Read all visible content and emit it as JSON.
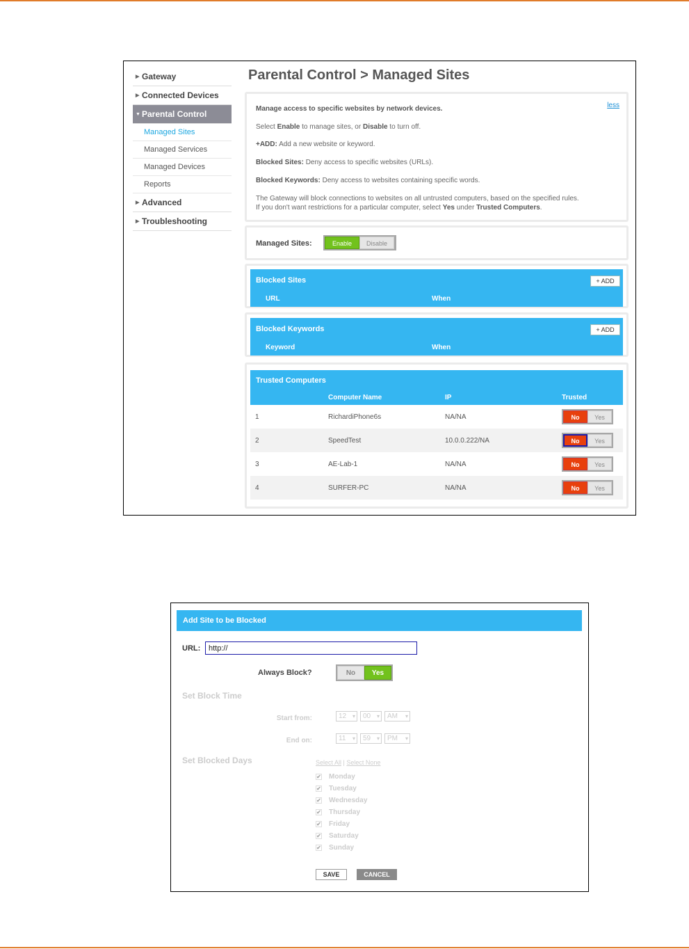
{
  "sidebar": {
    "items": [
      {
        "label": "Gateway"
      },
      {
        "label": "Connected Devices"
      },
      {
        "label": "Parental Control"
      },
      {
        "label": "Managed Sites"
      },
      {
        "label": "Managed Services"
      },
      {
        "label": "Managed Devices"
      },
      {
        "label": "Reports"
      },
      {
        "label": "Advanced"
      },
      {
        "label": "Troubleshooting"
      }
    ]
  },
  "page": {
    "title": "Parental Control > Managed Sites"
  },
  "info": {
    "less": "less",
    "line1": "Manage access to specific websites by network devices.",
    "line2a": "Select ",
    "line2b": "Enable",
    "line2c": " to manage sites, or ",
    "line2d": "Disable",
    "line2e": " to turn off.",
    "line3a": "+ADD:",
    "line3b": " Add a new website or keyword.",
    "line4a": "Blocked Sites:",
    "line4b": " Deny access to specific websites (URLs).",
    "line5a": "Blocked Keywords:",
    "line5b": " Deny access to websites containing specific words.",
    "line6": "The Gateway will block connections to websites on all untrusted computers, based on the specified rules.",
    "line7a": "If you don't want restrictions for a particular computer, select ",
    "line7b": "Yes",
    "line7c": " under ",
    "line7d": "Trusted Computers",
    "line7e": "."
  },
  "managed_sites": {
    "label": "Managed Sites:",
    "enable": "Enable",
    "disable": "Disable"
  },
  "blocked_sites": {
    "title": "Blocked Sites",
    "add": "+ ADD",
    "col_url": "URL",
    "col_when": "When"
  },
  "blocked_keywords": {
    "title": "Blocked Keywords",
    "add": "+ ADD",
    "col_keyword": "Keyword",
    "col_when": "When"
  },
  "trusted": {
    "title": "Trusted Computers",
    "col_name": "Computer Name",
    "col_ip": "IP",
    "col_trusted": "Trusted",
    "no": "No",
    "yes": "Yes",
    "rows": [
      {
        "num": "1",
        "name": "RichardiPhone6s",
        "ip": "NA/NA"
      },
      {
        "num": "2",
        "name": "SpeedTest",
        "ip": "10.0.0.222/NA"
      },
      {
        "num": "3",
        "name": "AE-Lab-1",
        "ip": "NA/NA"
      },
      {
        "num": "4",
        "name": "SURFER-PC",
        "ip": "NA/NA"
      }
    ]
  },
  "dialog": {
    "title": "Add Site to be Blocked",
    "url_label": "URL:",
    "url_value": "http://",
    "always_label": "Always Block?",
    "no": "No",
    "yes": "Yes",
    "block_time": "Set Block Time",
    "start_label": "Start from:",
    "end_label": "End on:",
    "start": {
      "hour": "12",
      "min": "00",
      "ampm": "AM"
    },
    "end": {
      "hour": "11",
      "min": "59",
      "ampm": "PM"
    },
    "blocked_days": "Set Blocked Days",
    "select_all": "Select All",
    "separator": "|",
    "select_none": "Select None",
    "days": [
      "Monday",
      "Tuesday",
      "Wednesday",
      "Thursday",
      "Friday",
      "Saturday",
      "Sunday"
    ],
    "check": "✔",
    "save": "SAVE",
    "cancel": "CANCEL"
  },
  "colors": {
    "accent_blue": "#35b6f1",
    "enable_green": "#72c21d",
    "no_red": "#e8400d",
    "rule_orange": "#e07b2a"
  }
}
